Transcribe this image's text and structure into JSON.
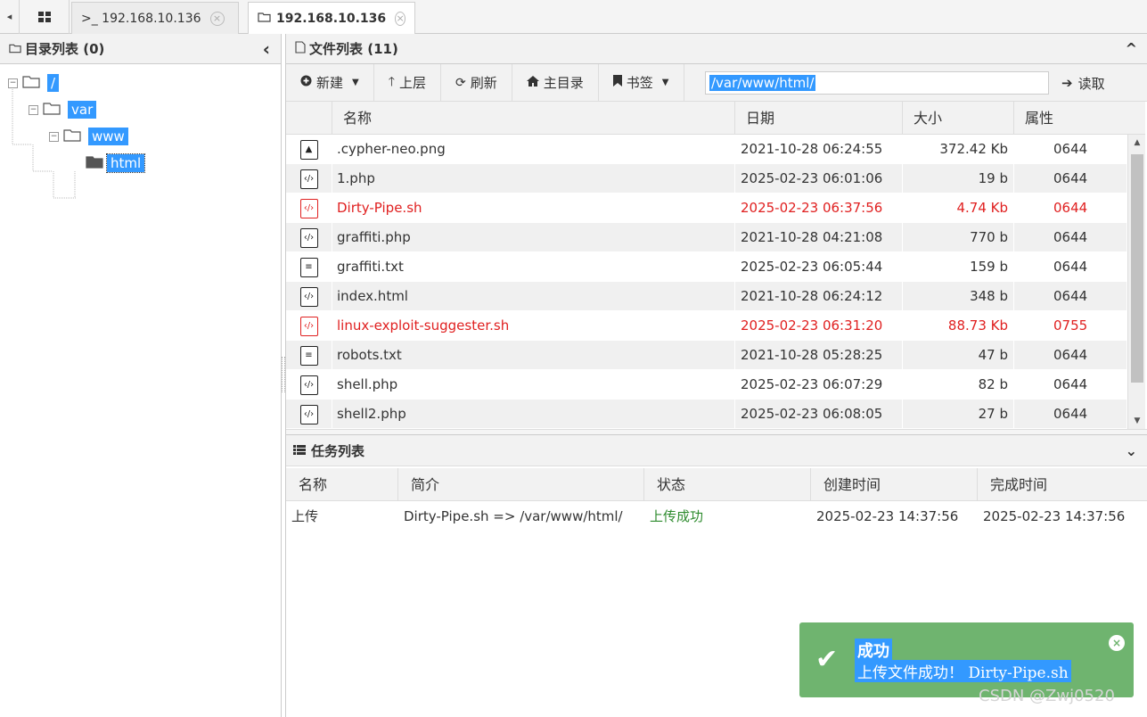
{
  "tabs": {
    "prev_arrow": "◂",
    "grid_icon": "grid-icon",
    "items": [
      {
        "label": ">_ 192.168.10.136",
        "close": "×"
      },
      {
        "label": "192.168.10.136",
        "close": "×"
      }
    ]
  },
  "dir_panel": {
    "title": "目录列表 (0)",
    "collapse": "‹",
    "tree": [
      {
        "label": "/",
        "toggle": "−"
      },
      {
        "label": "var",
        "toggle": "−"
      },
      {
        "label": "www",
        "toggle": "−"
      },
      {
        "label": "html"
      }
    ]
  },
  "file_panel": {
    "title": "文件列表 (11)",
    "collapse": "^",
    "toolbar": {
      "new": "新建",
      "up": "上层",
      "refresh": "刷新",
      "home": "主目录",
      "bookmark": "书签",
      "path": "/var/www/html/",
      "read": "读取"
    },
    "columns": [
      "名称",
      "日期",
      "大小",
      "属性"
    ],
    "files": [
      {
        "name": ".cypher-neo.png",
        "date": "2021-10-28 06:24:55",
        "size": "372.42 Kb",
        "perm": "0644",
        "icon": "image-file-icon",
        "highlight": false
      },
      {
        "name": "1.php",
        "date": "2025-02-23 06:01:06",
        "size": "19 b",
        "perm": "0644",
        "icon": "code-file-icon",
        "highlight": false
      },
      {
        "name": "Dirty-Pipe.sh",
        "date": "2025-02-23 06:37:56",
        "size": "4.74 Kb",
        "perm": "0644",
        "icon": "code-file-icon",
        "highlight": true
      },
      {
        "name": "graffiti.php",
        "date": "2021-10-28 04:21:08",
        "size": "770 b",
        "perm": "0644",
        "icon": "code-file-icon",
        "highlight": false
      },
      {
        "name": "graffiti.txt",
        "date": "2025-02-23 06:05:44",
        "size": "159 b",
        "perm": "0644",
        "icon": "text-file-icon",
        "highlight": false
      },
      {
        "name": "index.html",
        "date": "2021-10-28 06:24:12",
        "size": "348 b",
        "perm": "0644",
        "icon": "code-file-icon",
        "highlight": false
      },
      {
        "name": "linux-exploit-suggester.sh",
        "date": "2025-02-23 06:31:20",
        "size": "88.73 Kb",
        "perm": "0755",
        "icon": "code-file-icon",
        "highlight": true
      },
      {
        "name": "robots.txt",
        "date": "2021-10-28 05:28:25",
        "size": "47 b",
        "perm": "0644",
        "icon": "text-file-icon",
        "highlight": false
      },
      {
        "name": "shell.php",
        "date": "2025-02-23 06:07:29",
        "size": "82 b",
        "perm": "0644",
        "icon": "code-file-icon",
        "highlight": false
      },
      {
        "name": "shell2.php",
        "date": "2025-02-23 06:08:05",
        "size": "27 b",
        "perm": "0644",
        "icon": "code-file-icon",
        "highlight": false
      }
    ]
  },
  "task_panel": {
    "title": "任务列表",
    "collapse": "⌄",
    "columns": [
      "名称",
      "简介",
      "状态",
      "创建时间",
      "完成时间"
    ],
    "rows": [
      {
        "name": "上传",
        "desc": "Dirty-Pipe.sh => /var/www/html/",
        "status": "上传成功",
        "created": "2025-02-23 14:37:56",
        "finished": "2025-02-23 14:37:56"
      }
    ]
  },
  "toast": {
    "title": "成功",
    "message": "上传文件成功！ Dirty-Pipe.sh",
    "close": "×"
  },
  "watermark": "CSDN @Zwj0520",
  "colors": {
    "highlight_red": "#e02020",
    "success_green": "#2e8b2e",
    "toast_bg": "#6fb46f",
    "selection_blue": "#3399ff"
  }
}
